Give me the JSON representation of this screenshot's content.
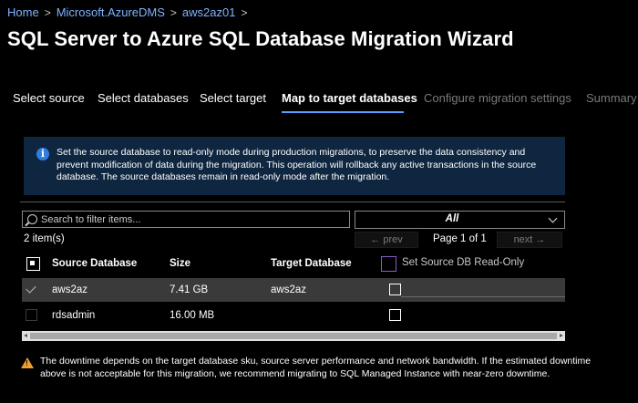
{
  "breadcrumb": [
    "Home",
    "Microsoft.AzureDMS",
    "aws2az01"
  ],
  "page_title": "SQL Server to Azure SQL Database Migration Wizard",
  "more_label": "···",
  "tabs": [
    {
      "label": "Select source",
      "state": "normal"
    },
    {
      "label": "Select databases",
      "state": "normal"
    },
    {
      "label": "Select target",
      "state": "normal"
    },
    {
      "label": "Map to target databases",
      "state": "active"
    },
    {
      "label": "Configure migration settings",
      "state": "disabled"
    },
    {
      "label": "Summary",
      "state": "disabled"
    }
  ],
  "info": {
    "icon": "info-icon",
    "text": "Set the source database to read-only mode during production migrations, to preserve the data consistency and prevent modification of data during the migration. This operation will rollback any active transactions in the source database. The source databases remain in read-only mode after the migration."
  },
  "search": {
    "placeholder": "Search to filter items..."
  },
  "filter": {
    "value": "All"
  },
  "item_count": "2 item(s)",
  "pager": {
    "prev": "← prev",
    "page": "Page 1 of 1",
    "next": "next →"
  },
  "table": {
    "columns": {
      "source": "Source Database",
      "size": "Size",
      "target": "Target Database",
      "readonly": "Set Source DB Read-Only"
    },
    "rows": [
      {
        "source": "aws2az",
        "size": "7.41 GB",
        "target": "aws2az",
        "selected": true
      },
      {
        "source": "rdsadmin",
        "size": "16.00 MB",
        "target": "",
        "selected": false
      }
    ]
  },
  "warning": {
    "icon": "warning-icon",
    "text": "The downtime depends on the target database sku, source server performance and network bandwidth.  If the estimated downtime above is not acceptable for this migration, we recommend migrating to SQL Managed Instance with near-zero downtime."
  },
  "colors": {
    "accent": "#5a9fff",
    "info_bg": "#0e2640",
    "warning": "#f0a030",
    "selected_row": "#3a3a3a"
  }
}
